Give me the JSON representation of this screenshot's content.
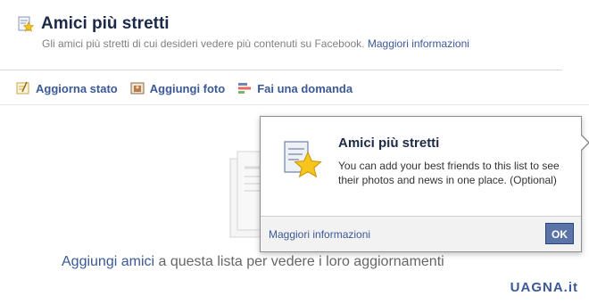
{
  "header": {
    "title": "Amici più stretti",
    "subtitle": "Gli amici più stretti di cui desideri vedere più contenuti su Facebook.",
    "subtitle_link": "Maggiori informazioni",
    "icon": "star-list-icon"
  },
  "composer": {
    "items": [
      {
        "label": "Aggiorna stato",
        "icon": "status-icon"
      },
      {
        "label": "Aggiungi foto",
        "icon": "photo-icon"
      },
      {
        "label": "Fai una domanda",
        "icon": "question-icon"
      }
    ]
  },
  "empty_state": {
    "link": "Aggiungi amici",
    "text": " a questa lista per vedere i loro aggiornamenti"
  },
  "popup": {
    "title": "Amici più stretti",
    "body": "You can add your best friends to this list to see their photos and news in one place. (Optional)",
    "learn_more": "Maggiori informazioni",
    "ok_label": "OK",
    "icon": "star-list-icon"
  },
  "watermark": "UAGNA.it",
  "colors": {
    "link": "#3b5998",
    "title": "#1c2a47",
    "ok_button": "#5b74a8"
  }
}
